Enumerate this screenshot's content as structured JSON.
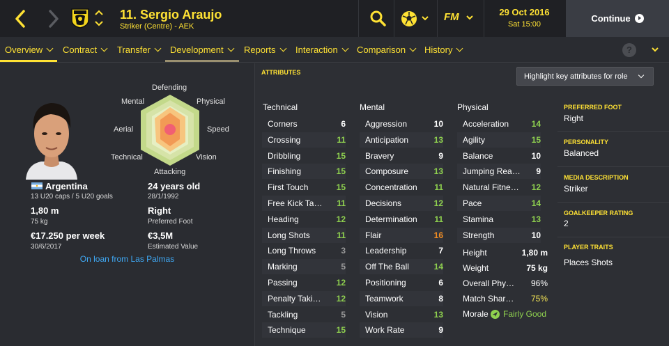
{
  "header": {
    "player_title": "11. Sergio Araujo",
    "player_subtitle": "Striker (Centre) - AEK",
    "date": "29 Oct 2016",
    "time": "Sat 15:00",
    "continue_label": "Continue",
    "fm_logo": "FM"
  },
  "menu": {
    "items": [
      {
        "label": "Overview"
      },
      {
        "label": "Contract"
      },
      {
        "label": "Transfer"
      },
      {
        "label": "Development"
      },
      {
        "label": "Reports"
      },
      {
        "label": "Interaction"
      },
      {
        "label": "Comparison"
      },
      {
        "label": "History"
      }
    ],
    "help_label": "?"
  },
  "bio": {
    "nationality": "Argentina",
    "caps": "13 U20 caps / 5 U20 goals",
    "height": "1,80 m",
    "weight": "75 kg",
    "wage": "€17.250 per week",
    "contract_end": "30/6/2017",
    "age": "24 years old",
    "dob": "28/1/1992",
    "foot": "Right",
    "foot_label": "Preferred Foot",
    "value": "€3,5M",
    "value_label": "Estimated Value",
    "loan": "On loan from Las Palmas"
  },
  "radar": {
    "labels": {
      "defending": "Defending",
      "physical": "Physical",
      "speed": "Speed",
      "vision": "Vision",
      "attacking": "Attacking",
      "technical": "Technical",
      "aerial": "Aerial",
      "mental": "Mental"
    }
  },
  "attributes": {
    "title": "ATTRIBUTES",
    "highlight_label": "Highlight key attributes for role",
    "technical_head": "Technical",
    "mental_head": "Mental",
    "physical_head": "Physical",
    "technical": [
      {
        "name": "Corners",
        "value": "6"
      },
      {
        "name": "Crossing",
        "value": "11"
      },
      {
        "name": "Dribbling",
        "value": "15"
      },
      {
        "name": "Finishing",
        "value": "15"
      },
      {
        "name": "First Touch",
        "value": "15"
      },
      {
        "name": "Free Kick Ta…",
        "value": "11"
      },
      {
        "name": "Heading",
        "value": "12"
      },
      {
        "name": "Long Shots",
        "value": "11"
      },
      {
        "name": "Long Throws",
        "value": "3"
      },
      {
        "name": "Marking",
        "value": "5"
      },
      {
        "name": "Passing",
        "value": "12"
      },
      {
        "name": "Penalty Taki…",
        "value": "12"
      },
      {
        "name": "Tackling",
        "value": "5"
      },
      {
        "name": "Technique",
        "value": "15"
      }
    ],
    "mental": [
      {
        "name": "Aggression",
        "value": "10"
      },
      {
        "name": "Anticipation",
        "value": "13"
      },
      {
        "name": "Bravery",
        "value": "9"
      },
      {
        "name": "Composure",
        "value": "13"
      },
      {
        "name": "Concentration",
        "value": "11"
      },
      {
        "name": "Decisions",
        "value": "12"
      },
      {
        "name": "Determination",
        "value": "11"
      },
      {
        "name": "Flair",
        "value": "16"
      },
      {
        "name": "Leadership",
        "value": "7"
      },
      {
        "name": "Off The Ball",
        "value": "14"
      },
      {
        "name": "Positioning",
        "value": "6"
      },
      {
        "name": "Teamwork",
        "value": "8"
      },
      {
        "name": "Vision",
        "value": "13"
      },
      {
        "name": "Work Rate",
        "value": "9"
      }
    ],
    "physical": [
      {
        "name": "Acceleration",
        "value": "14"
      },
      {
        "name": "Agility",
        "value": "15"
      },
      {
        "name": "Balance",
        "value": "10"
      },
      {
        "name": "Jumping Rea…",
        "value": "9"
      },
      {
        "name": "Natural Fitne…",
        "value": "12"
      },
      {
        "name": "Pace",
        "value": "14"
      },
      {
        "name": "Stamina",
        "value": "13"
      },
      {
        "name": "Strength",
        "value": "10"
      }
    ],
    "physical_info": [
      {
        "name": "Height",
        "value": "1,80 m"
      },
      {
        "name": "Weight",
        "value": "75 kg"
      },
      {
        "name": "Overall Phy…",
        "value": "96%"
      },
      {
        "name": "Match Shar…",
        "value": "75%"
      },
      {
        "name": "Morale",
        "value": "Fairly Good"
      }
    ]
  },
  "side": {
    "preferred_foot_head": "PREFERRED FOOT",
    "preferred_foot": "Right",
    "personality_head": "PERSONALITY",
    "personality": "Balanced",
    "media_head": "MEDIA DESCRIPTION",
    "media": "Striker",
    "gk_head": "GOALKEEPER RATING",
    "gk": "2",
    "traits_head": "PLAYER TRAITS",
    "traits": "Places Shots"
  },
  "colors": {
    "accent": "#ffe234",
    "bg": "#2a2c31",
    "topbar": "#1f2024",
    "value_green": "#8fd14f",
    "value_white": "#ffffff",
    "value_grey": "#9a9a9a",
    "value_orange": "#f08c22",
    "link": "#3fa9f5"
  }
}
